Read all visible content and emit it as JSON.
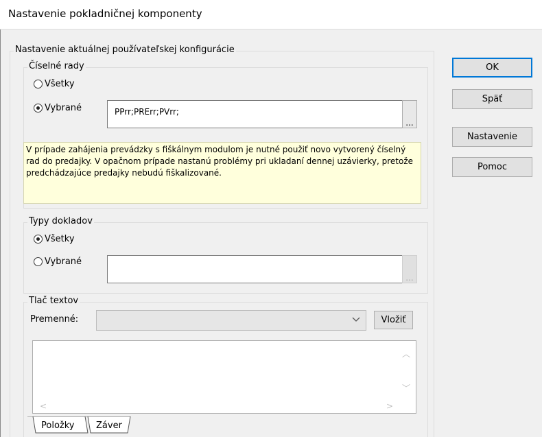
{
  "window": {
    "title": "Nastavenie pokladničnej komponenty"
  },
  "config_group": {
    "label": "Nastavenie aktuálnej používateľskej konfigurácie"
  },
  "ciselne_rady": {
    "label": "Číselné rady",
    "radio_all": "Všetky",
    "radio_selected": "Vybrané",
    "selected_option": "Vybrané",
    "value": "PPrr;PRErr;PVrr;",
    "browse": "..."
  },
  "info": {
    "text": "V prípade zahájenia prevádzky s fiškálnym modulom je nutné použiť novo vytvorený číselný rad do predajky. V opačnom prípade nastanú problémy pri ukladaní dennej uzávierky, pretože predchádzajúce predajky nebudú fiškalizované."
  },
  "typy_dokladov": {
    "label": "Typy dokladov",
    "radio_all": "Všetky",
    "radio_selected": "Vybrané",
    "selected_option": "Všetky",
    "value": "",
    "browse": "..."
  },
  "tlac_textov": {
    "label": "Tlač textov",
    "variables_label": "Premenné:",
    "variables_value": "",
    "insert_button": "Vložiť",
    "text_value": ""
  },
  "tabs": [
    {
      "label": "Položky",
      "active": true
    },
    {
      "label": "Záver",
      "active": false
    }
  ],
  "buttons": {
    "ok": "OK",
    "back": "Späť",
    "settings": "Nastavenie",
    "help": "Pomoc"
  },
  "icons": {
    "radio_checked": "radio-checked-icon",
    "radio_unchecked": "radio-unchecked-icon",
    "dropdown": "chevron-down-icon",
    "scroll_up": "scroll-up-icon",
    "scroll_down": "scroll-down-icon",
    "scroll_left": "scroll-left-icon",
    "scroll_right": "scroll-right-icon"
  },
  "colors": {
    "info_background": "#ffffdc",
    "default_button_border": "#0078d7",
    "dialog_background": "#f0f0f0"
  }
}
